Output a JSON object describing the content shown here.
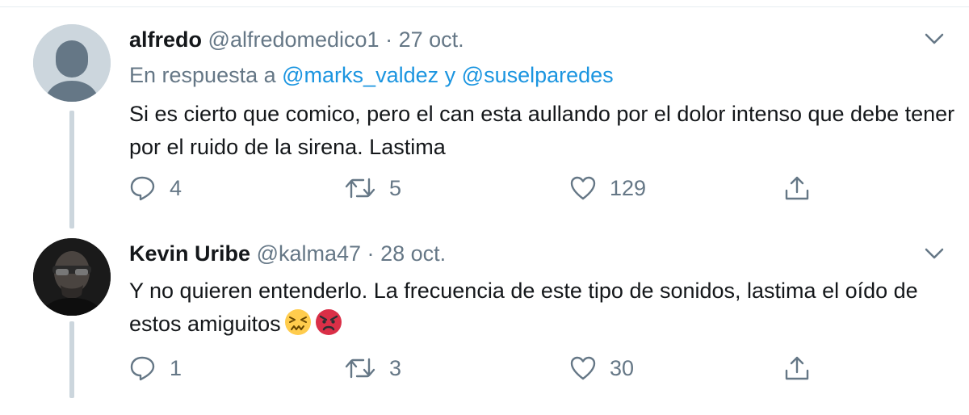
{
  "tweets": [
    {
      "name": "alfredo",
      "handle": "@alfredomedico1",
      "separator": "·",
      "date": "27 oct.",
      "reply_prefix": "En respuesta a",
      "reply_mention_1": "@marks_valdez",
      "reply_joiner": "y",
      "reply_mention_2": "@suselparedes",
      "text": "Si es cierto que comico, pero el can esta aullando por el dolor intenso que debe tener por el ruido de la sirena. Lastima",
      "replies": "4",
      "retweets": "5",
      "likes": "129",
      "avatar_icon": "default-avatar-icon"
    },
    {
      "name": "Kevin Uribe",
      "handle": "@kalma47",
      "separator": "·",
      "date": "28 oct.",
      "text": "Y no quieren entenderlo. La frecuencia de este tipo de sonidos, lastima el oído de estos amiguitos",
      "emojis": [
        "confounded-face-emoji",
        "angry-face-emoji"
      ],
      "replies": "1",
      "retweets": "3",
      "likes": "30",
      "avatar_icon": "photo-avatar"
    }
  ],
  "icons": [
    "caret-down-icon",
    "reply-icon",
    "retweet-icon",
    "like-icon",
    "share-icon"
  ],
  "colors": {
    "text": "#14171a",
    "secondary": "#657786",
    "link": "#1b95e0",
    "border": "#e6ecf0",
    "thread_line": "#ccd6dd"
  }
}
